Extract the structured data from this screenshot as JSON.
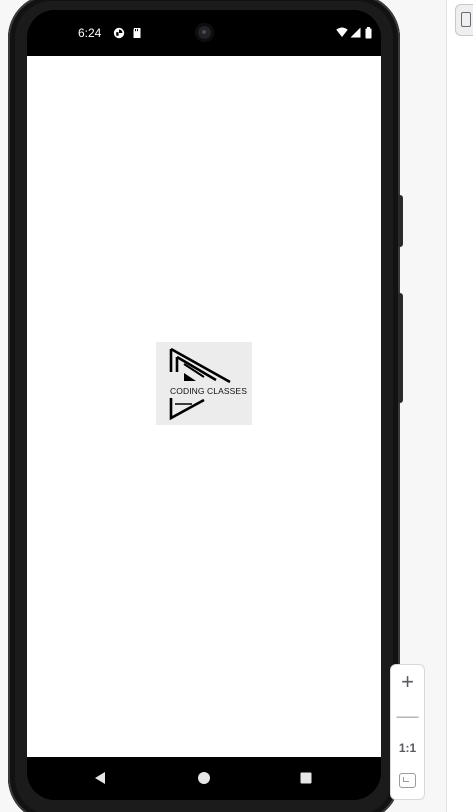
{
  "status_bar": {
    "time": "6:24"
  },
  "app": {
    "logo_text": "CODING CLASSES"
  },
  "nav_bar": {
    "back_icon": "back-triangle-icon",
    "home_icon": "home-circle-icon",
    "recents_icon": "recents-square-icon"
  },
  "zoom_controls": {
    "plus_label": "+",
    "minus_label": "—",
    "ratio_label": "1:1"
  }
}
